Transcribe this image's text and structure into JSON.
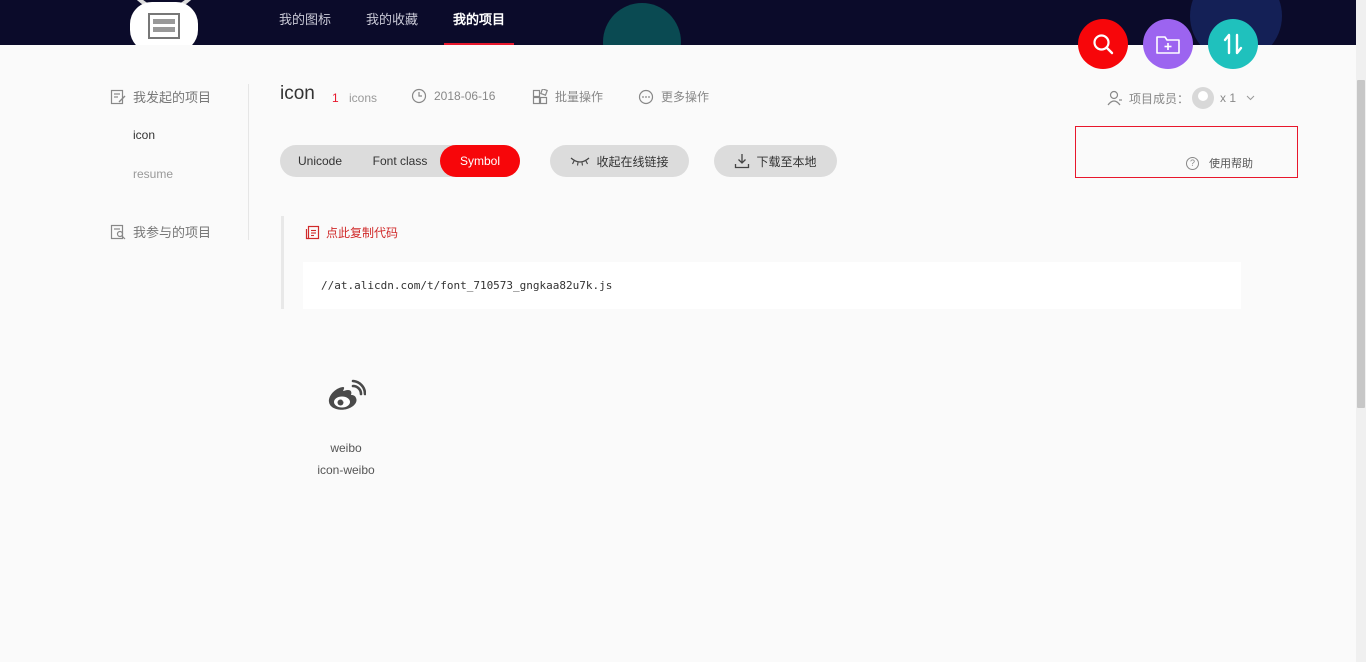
{
  "header": {
    "nav": [
      {
        "label": "我的图标"
      },
      {
        "label": "我的收藏"
      },
      {
        "label": "我的项目",
        "active": true
      }
    ],
    "fab_icons": [
      "search-icon",
      "add-folder-icon",
      "sort-icon"
    ]
  },
  "sidebar": {
    "owned_label": "我发起的项目",
    "projects": [
      {
        "label": "icon",
        "selected": true
      },
      {
        "label": "resume"
      }
    ],
    "joined_label": "我参与的项目"
  },
  "project": {
    "title": "icon",
    "count": "1",
    "count_label": "icons",
    "date": "2018-06-16",
    "batch_label": "批量操作",
    "more_label": "更多操作",
    "members_label": "项目成员：",
    "members_count": "x 1"
  },
  "tabs": [
    {
      "label": "Unicode"
    },
    {
      "label": "Font class"
    },
    {
      "label": "Symbol",
      "active": true
    }
  ],
  "actions": {
    "online_link": "收起在线链接",
    "download": "下载至本地",
    "help": "使用帮助",
    "help_q": "?"
  },
  "code": {
    "copy_label": "点此复制代码",
    "url": "//at.alicdn.com/t/font_710573_gngkaa82u7k.js"
  },
  "icons": [
    {
      "name": "weibo",
      "code": "icon-weibo",
      "icon": "weibo-icon"
    }
  ],
  "colors": {
    "accent": "#f7060a",
    "header_bg": "#0b0b2a",
    "fab_add": "#9c64f0",
    "fab_sort": "#1fc1bd"
  }
}
